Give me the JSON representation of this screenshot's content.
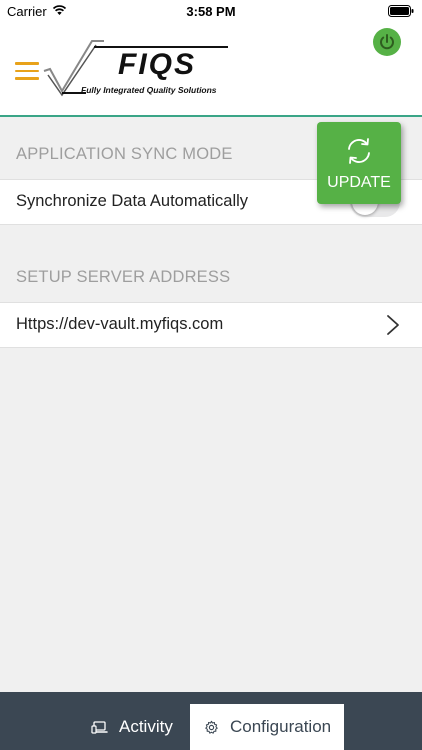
{
  "status_bar": {
    "carrier": "Carrier",
    "time": "3:58 PM",
    "wifi_icon": "wifi-icon",
    "battery_icon": "battery-icon"
  },
  "header": {
    "menu_icon": "hamburger-menu-icon",
    "logo_text": "FIQS",
    "logo_tagline": "Fully Integrated Quality Solutions",
    "power_icon": "power-icon",
    "accent_color": "#3aa587",
    "menu_color": "#e8a21a"
  },
  "sections": {
    "sync": {
      "title": "APPLICATION SYNC MODE",
      "row_label": "Synchronize Data Automatically",
      "toggle_on": false
    },
    "server": {
      "title": "SETUP SERVER ADDRESS",
      "address": "Https://dev-vault.myfiqs.com",
      "chevron_icon": "chevron-right-icon"
    }
  },
  "update_button": {
    "label": "UPDATE",
    "icon": "sync-icon",
    "color": "#56b146"
  },
  "tab_bar": {
    "background": "#3b4753",
    "tabs": [
      {
        "label": "Activity",
        "icon": "laptop-icon",
        "selected": false
      },
      {
        "label": "Configuration",
        "icon": "gear-icon",
        "selected": true
      }
    ]
  }
}
